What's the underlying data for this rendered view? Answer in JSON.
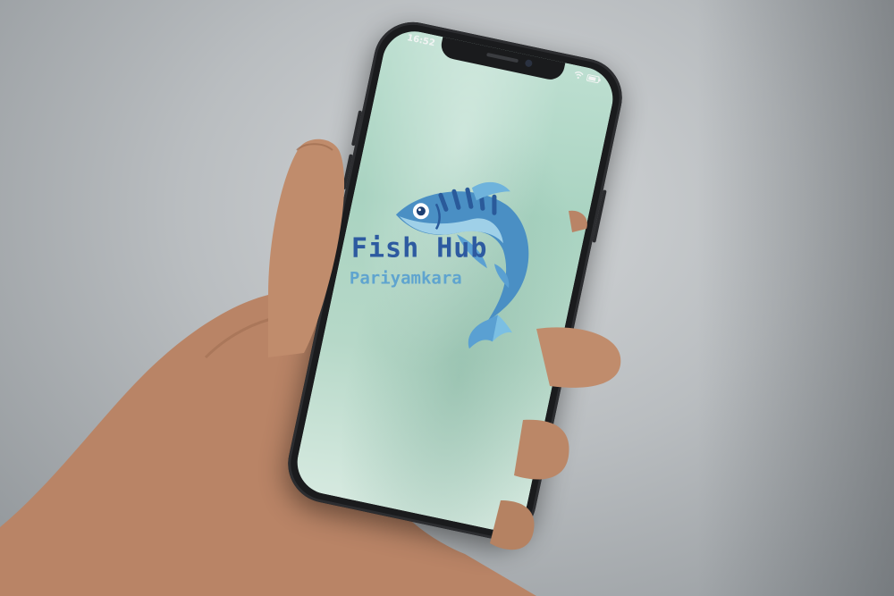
{
  "status_bar": {
    "time": "16:52"
  },
  "splash": {
    "app_name": "Fish Hub",
    "subtitle": "Pariyamkara",
    "icons": {
      "logo": "fish-icon",
      "wifi": "wifi-icon",
      "battery": "battery-icon"
    }
  },
  "colors": {
    "brand_blue": "#2d5aa0",
    "subtitle_blue": "#5fa4cf",
    "screen_green": "#a9d3c1"
  }
}
